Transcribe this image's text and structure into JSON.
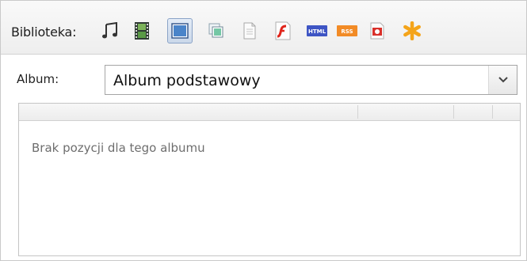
{
  "toolbar": {
    "label": "Biblioteka:",
    "icons": [
      {
        "name": "music-icon"
      },
      {
        "name": "film-icon"
      },
      {
        "name": "image-icon",
        "active": true
      },
      {
        "name": "gallery-icon"
      },
      {
        "name": "document-icon"
      },
      {
        "name": "flash-icon"
      },
      {
        "name": "html-icon",
        "text": "HTML"
      },
      {
        "name": "rss-icon",
        "text": "RSS"
      },
      {
        "name": "presentation-icon"
      },
      {
        "name": "asterisk-icon"
      }
    ]
  },
  "album": {
    "label": "Album:",
    "selected": "Album podstawowy"
  },
  "table": {
    "empty_message": "Brak pozycji dla tego albumu"
  },
  "colors": {
    "active_border": "#8aa3c7",
    "flash_red": "#e0251b",
    "asterisk_orange": "#f4a41a"
  }
}
